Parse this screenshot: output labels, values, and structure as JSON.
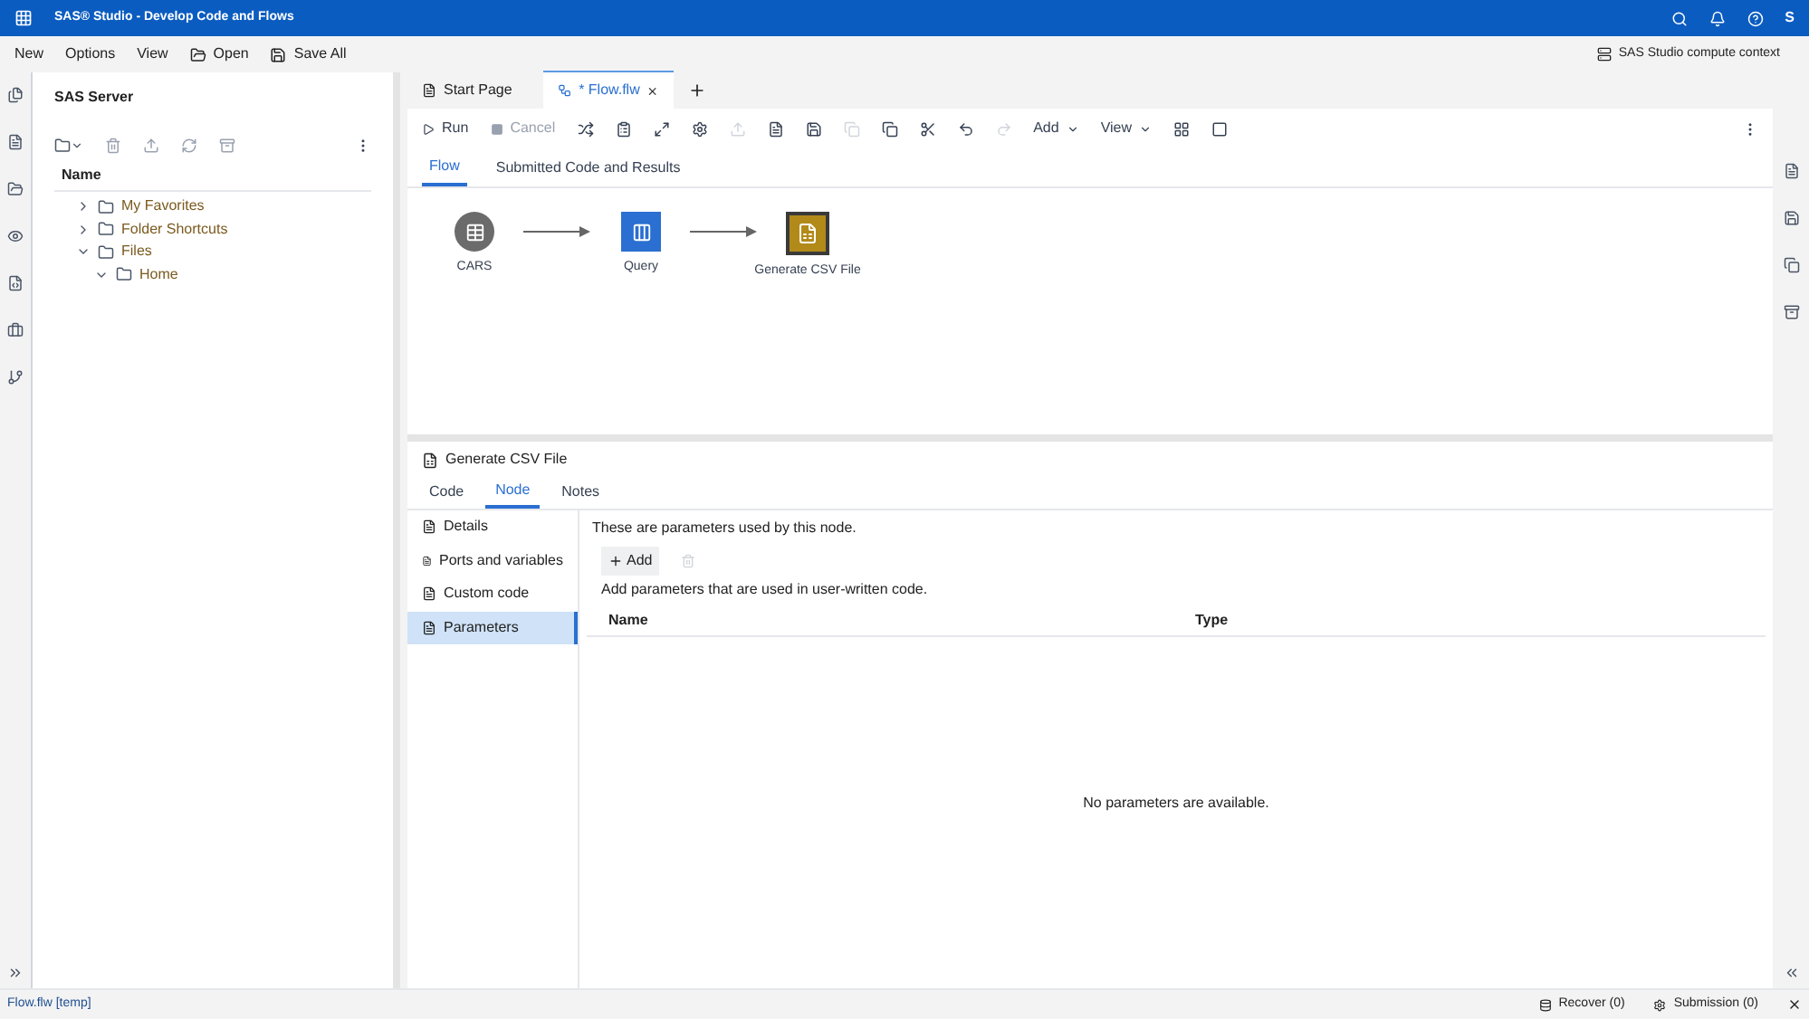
{
  "app_bar": {
    "title": "SAS® Studio - Develop Code and Flows",
    "user_initial": "S"
  },
  "menu": {
    "items": [
      "New",
      "Options",
      "View"
    ],
    "open": "Open",
    "save_all": "Save All",
    "compute_context": "SAS Studio compute context"
  },
  "left_panel": {
    "title": "SAS Server",
    "column": "Name",
    "tree": [
      {
        "label": "My Favorites",
        "expanded": false
      },
      {
        "label": "Folder Shortcuts",
        "expanded": false
      },
      {
        "label": "Files",
        "expanded": true,
        "children": [
          {
            "label": "Home",
            "expanded": true
          }
        ]
      }
    ]
  },
  "tabs": [
    {
      "label": "Start Page",
      "selected": false,
      "kind": "page"
    },
    {
      "label": "* Flow.flw",
      "selected": true,
      "kind": "flow"
    }
  ],
  "toolbar": {
    "run": {
      "label": "Run",
      "disabled": false
    },
    "cancel": {
      "label": "Cancel",
      "disabled": true
    },
    "add": "Add",
    "view": "View"
  },
  "flow_tabs": [
    {
      "label": "Flow",
      "selected": true
    },
    {
      "label": "Submitted Code and Results",
      "selected": false
    }
  ],
  "nodes": [
    {
      "label": "CARS",
      "kind": "table"
    },
    {
      "label": "Query",
      "kind": "query"
    },
    {
      "label": "Generate CSV File",
      "kind": "csv"
    }
  ],
  "properties": {
    "title": "Generate CSV File",
    "tabs": [
      {
        "label": "Code",
        "selected": false
      },
      {
        "label": "Node",
        "selected": true
      },
      {
        "label": "Notes",
        "selected": false
      }
    ],
    "nav": [
      {
        "label": "Details",
        "selected": false
      },
      {
        "label": "Ports and variables",
        "selected": false
      },
      {
        "label": "Custom code",
        "selected": false
      },
      {
        "label": "Parameters",
        "selected": true
      }
    ],
    "intro": "These are parameters used by this node.",
    "add_button": "Add",
    "hint": "Add parameters that are used in user-written code.",
    "columns": [
      "Name",
      "Type"
    ],
    "empty": "No parameters are available."
  },
  "status_bar": {
    "file": "Flow.flw [temp]",
    "recover": "Recover (0)",
    "submission": "Submission (0)"
  }
}
